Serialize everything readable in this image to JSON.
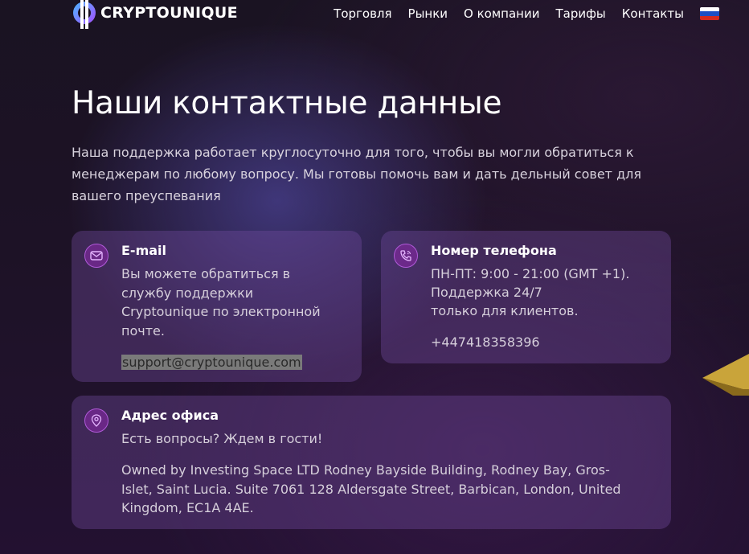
{
  "brand": {
    "name": "CRYPTOUNIQUE"
  },
  "nav": {
    "items": [
      "Торговля",
      "Рынки",
      "О компании",
      "Тарифы",
      "Контакты"
    ],
    "language_icon": "russia-flag-icon"
  },
  "page": {
    "title": "Наши контактные данные",
    "intro": "Наша поддержка работает круглосуточно для того, чтобы вы могли обратиться к менеджерам по любому вопросу. Мы готовы помочь вам и дать дельный совет для вашего преуспевания"
  },
  "email_card": {
    "icon": "mail-icon",
    "title": "E-mail",
    "text": "Вы можете обратиться в службу поддержки Cryptounique по электронной почте.",
    "email": "support@cryptounique.com"
  },
  "phone_card": {
    "icon": "phone-icon",
    "title": "Номер телефона",
    "line1": "ПН-ПТ: 9:00 - 21:00 (GMT +1).",
    "line2": "Поддержка 24/7",
    "line3": "только для клиентов.",
    "phone": "+447418358396"
  },
  "address_card": {
    "icon": "location-pin-icon",
    "title": "Адрес офиса",
    "text": "Есть вопросы? Ждем в гости!",
    "address": "Owned by Investing Space LTD Rodney Bayside Building, Rodney Bay, Gros-Islet, Saint Lucia. Suite 7061 128 Aldersgate Street, Barbican, London, United Kingdom, EC1A 4AE."
  },
  "colors": {
    "accent_link": "#46c6f0",
    "card_bg": "#5a3c80",
    "icon_ring": "#b05ad8",
    "background": "#1c1226"
  }
}
